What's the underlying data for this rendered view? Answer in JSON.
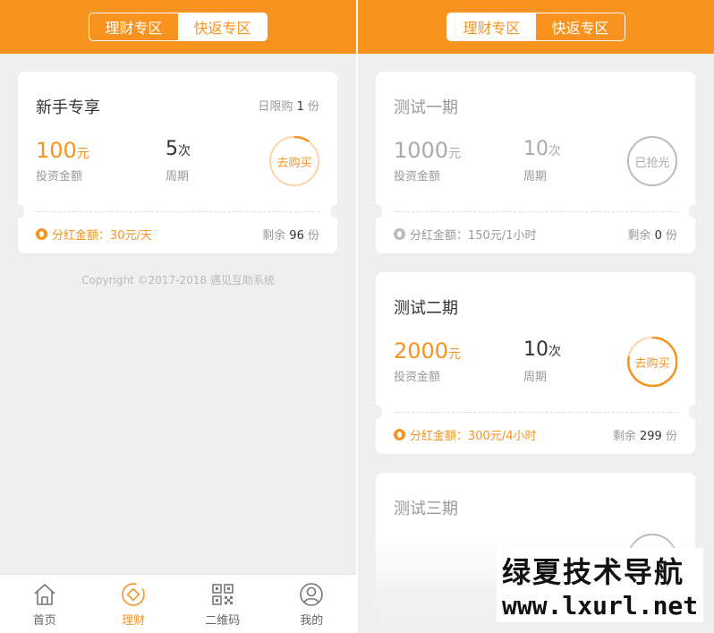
{
  "header": {
    "tab_finance": "理财专区",
    "tab_rebate": "快返专区"
  },
  "left": {
    "card": {
      "title": "新手专享",
      "limit_prefix": "日限购",
      "limit_count": "1",
      "limit_unit": "份",
      "amount_value": "100",
      "amount_unit": "元",
      "amount_label": "投资金额",
      "period_value": "5",
      "period_unit": "次",
      "period_label": "周期",
      "action": "去购买",
      "dividend": "分红金额：30元/天",
      "remain_prefix": "剩余",
      "remain_count": "96",
      "remain_unit": "份"
    },
    "copyright": "Copyright ©2017-2018 遇见互助系统"
  },
  "right": {
    "cards": [
      {
        "title": "测试一期",
        "amount_value": "1000",
        "amount_unit": "元",
        "amount_label": "投资金额",
        "period_value": "10",
        "period_unit": "次",
        "period_label": "周期",
        "action": "已抢光",
        "dividend": "分红金额：150元/1小时",
        "remain_prefix": "剩余",
        "remain_count": "0",
        "remain_unit": "份"
      },
      {
        "title": "测试二期",
        "amount_value": "2000",
        "amount_unit": "元",
        "amount_label": "投资金额",
        "period_value": "10",
        "period_unit": "次",
        "period_label": "周期",
        "action": "去购买",
        "dividend": "分红金额：300元/4小时",
        "remain_prefix": "剩余",
        "remain_count": "299",
        "remain_unit": "份"
      },
      {
        "title": "测试三期"
      }
    ]
  },
  "tabbar": {
    "items": [
      {
        "label": "首页",
        "icon": "home-icon"
      },
      {
        "label": "理财",
        "icon": "finance-icon"
      },
      {
        "label": "二维码",
        "icon": "qr-code-icon"
      },
      {
        "label": "我的",
        "icon": "user-icon"
      }
    ]
  },
  "watermark": {
    "line1": "绿夏技术导航",
    "line2": "www.lxurl.net"
  },
  "colors": {
    "accent": "#f7931e",
    "background": "#efefef"
  }
}
